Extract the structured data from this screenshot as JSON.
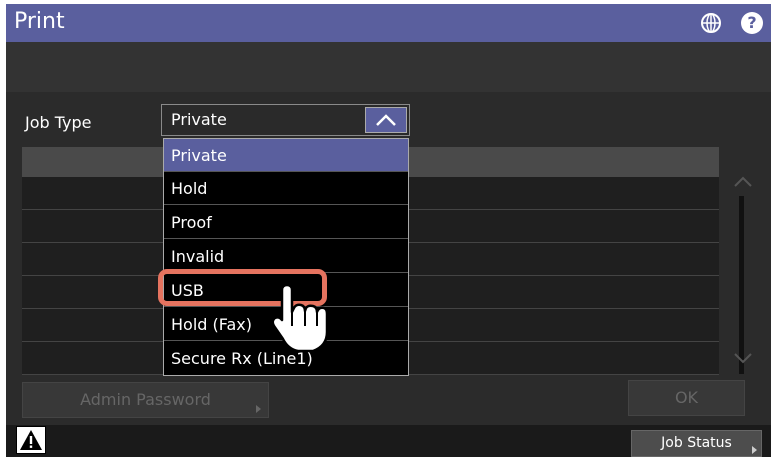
{
  "header": {
    "title": "Print",
    "globe_icon": "globe-icon",
    "help_label": "?"
  },
  "job_type": {
    "label": "Job Type",
    "selected": "Private",
    "options": [
      "Private",
      "Hold",
      "Proof",
      "Invalid",
      "USB",
      "Hold (Fax)",
      "Secure Rx (Line1)"
    ],
    "highlighted": "USB"
  },
  "buttons": {
    "admin_password": "Admin Password",
    "ok": "OK",
    "job_status": "Job Status"
  },
  "colors": {
    "accent": "#5a5f9e",
    "highlight": "#e5735f"
  }
}
